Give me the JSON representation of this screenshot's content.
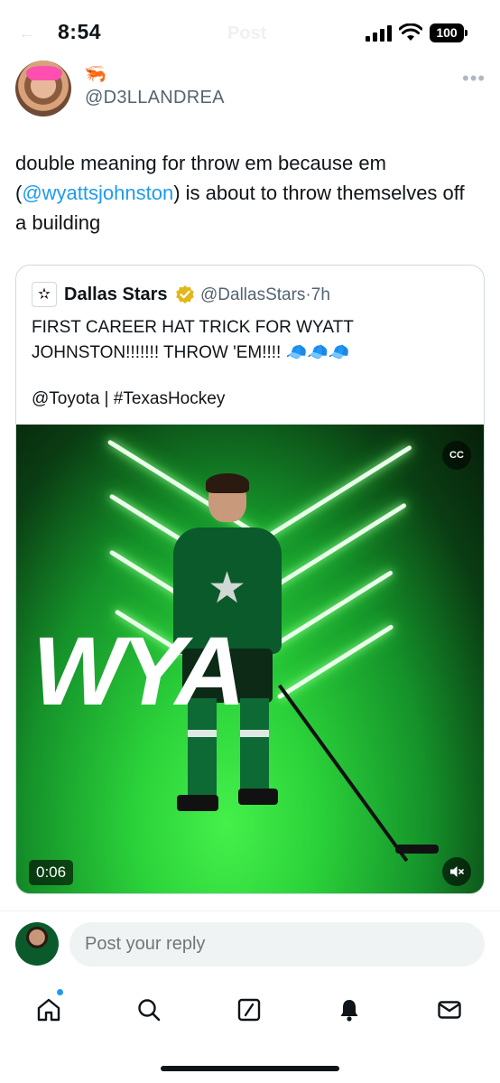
{
  "status_bar": {
    "time": "8:54",
    "battery": "100",
    "faded_back": "←",
    "faded_title": "Post"
  },
  "post": {
    "author_handle": "@D3LLANDREA",
    "author_emoji": "🦐",
    "text_before": "double meaning for throw em because em (",
    "mention": "@wyattsjohnston",
    "text_after": ") is about to throw themselves off a building",
    "more_icon": "more-icon"
  },
  "quote": {
    "name": "Dallas Stars",
    "handle": "@DallasStars·7h",
    "text": "FIRST CAREER HAT TRICK FOR WYATT JOHNSTON!!!!!!! THROW 'EM!!!! 🧢🧢🧢",
    "text2": "@Toyota | #TexasHockey",
    "video_overlay": "WYA",
    "video_time": "0:06",
    "logo_glyph": "✫"
  },
  "reply": {
    "placeholder": "Post your reply"
  },
  "tabs": [
    {
      "name": "home-icon",
      "active": true
    },
    {
      "name": "search-icon"
    },
    {
      "name": "grok-icon"
    },
    {
      "name": "notifications-icon"
    },
    {
      "name": "messages-icon"
    }
  ],
  "colors": {
    "accent": "#1d9bf0",
    "text": "#0f1419",
    "secondary": "#536471",
    "video_green": "#2bd23a"
  }
}
